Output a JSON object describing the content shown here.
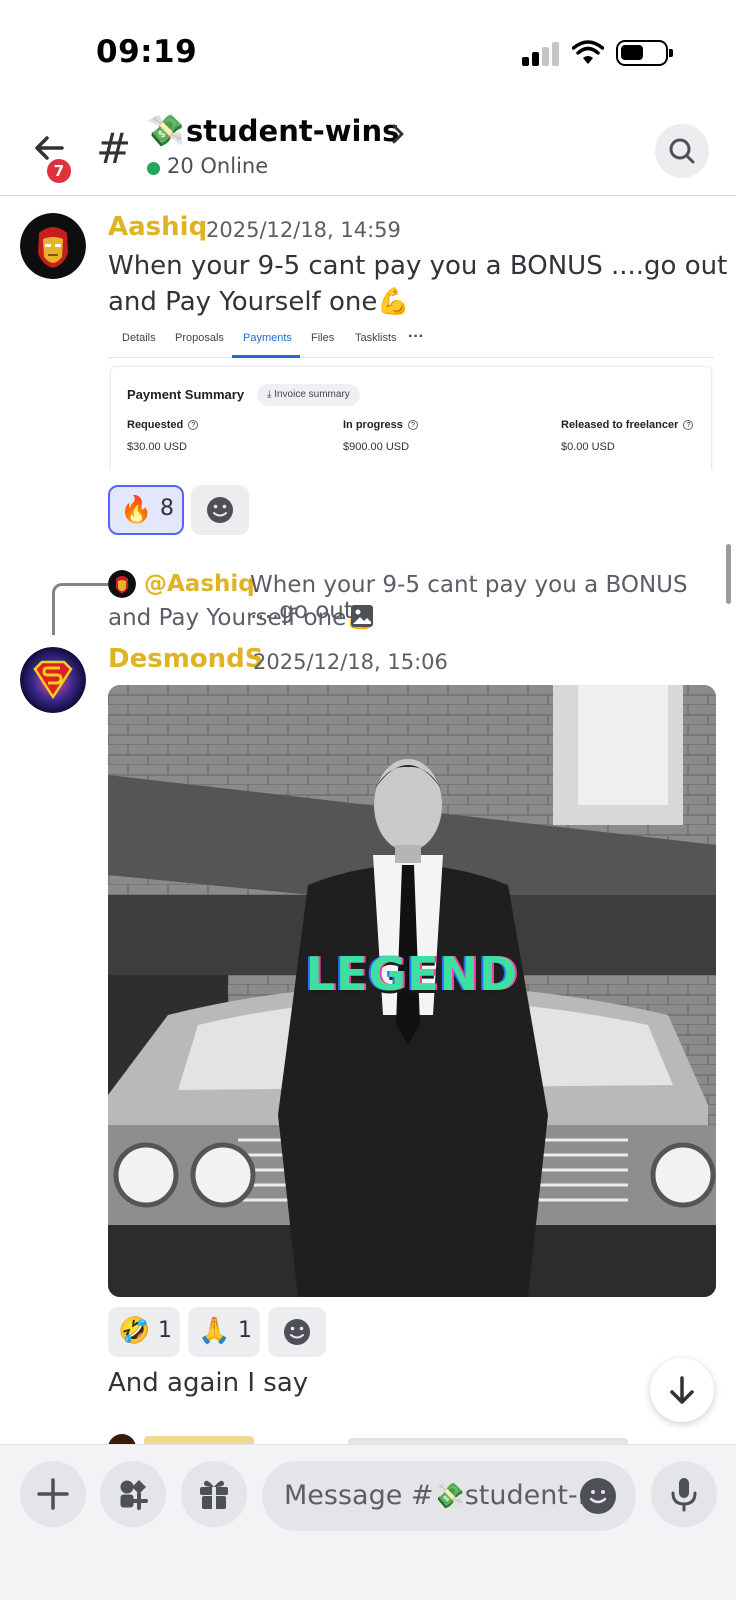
{
  "status_bar": {
    "time": "09:19"
  },
  "header": {
    "back_badge": "7",
    "channel_emoji": "💸",
    "channel_name": "student-wins",
    "online_text": "20 Online"
  },
  "messages": [
    {
      "username": "Aashiq",
      "timestamp": "2025/12/18, 14:59",
      "text_line1": "When your 9-5 cant pay you a BONUS ....go out",
      "text_line2": "and Pay Yourself one💪",
      "attachment": {
        "tabs": [
          "Details",
          "Proposals",
          "Payments",
          "Files",
          "Tasklists"
        ],
        "active_tab": "Payments",
        "more": "···",
        "title": "Payment Summary",
        "invoice_label": "⤓ Invoice summary",
        "columns": [
          {
            "label": "Requested",
            "value": "$30.00 USD"
          },
          {
            "label": "In progress",
            "value": "$900.00 USD"
          },
          {
            "label": "Released to freelancer",
            "value": "$0.00 USD"
          }
        ]
      },
      "reactions": [
        {
          "emoji": "🔥",
          "count": "8",
          "active": true
        }
      ]
    },
    {
      "reply": {
        "username": "@Aashiq",
        "text_line1": "When your 9-5 cant pay you a BONUS ....go out",
        "text_line2": "and Pay Yourself one💪"
      },
      "username": "DesmondS",
      "timestamp": "2025/12/18, 15:06",
      "gif_text": "LEGEND",
      "reactions": [
        {
          "emoji": "🤣",
          "count": "1"
        },
        {
          "emoji": "🙏",
          "count": "1"
        }
      ],
      "followup_text": "And again I say"
    }
  ],
  "composer": {
    "placeholder_prefix": "Message #",
    "placeholder_emoji": "💸",
    "placeholder_suffix": "student-.."
  },
  "colors": {
    "username": "#e0b324",
    "online": "#23a55a",
    "badge": "#e0323d",
    "active_tab": "#1b6fd1",
    "gif_text": "#3de0a0"
  }
}
